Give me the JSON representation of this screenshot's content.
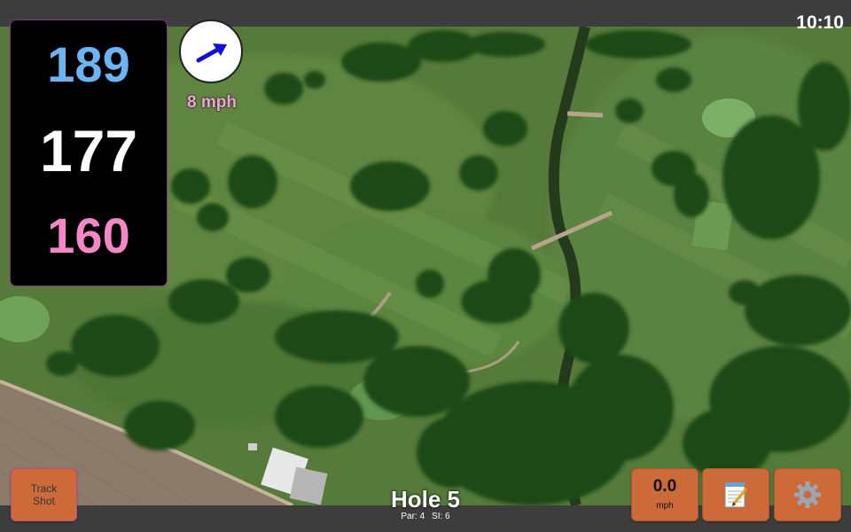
{
  "status_bar": {
    "time": "10:10"
  },
  "yardage": {
    "back": "189",
    "center": "177",
    "front": "160",
    "colors": {
      "back": "#6fb4f2",
      "center": "#ffffff",
      "front": "#f288c6"
    }
  },
  "wind": {
    "speed_label": "8 mph",
    "direction_icon": "arrow-icon",
    "arrow_color": "#1010d6",
    "label_color": "#f2a6dc"
  },
  "hole": {
    "title": "Hole 5",
    "par_label": "Par: 4",
    "si_label": "SI: 6"
  },
  "buttons": {
    "track_shot": "Track Shot",
    "speed_value": "0.0",
    "speed_unit": "mph",
    "notes_icon": "notepad-icon",
    "settings_icon": "gear-icon",
    "color": "#cc6a3a"
  },
  "map": {
    "type": "satellite-view"
  }
}
